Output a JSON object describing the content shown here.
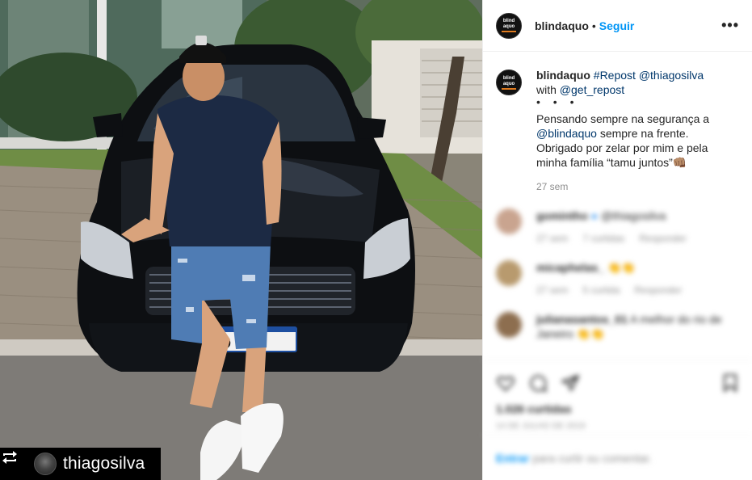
{
  "photo": {
    "repost_user": "thiagosilva",
    "plate_text": "FD  98"
  },
  "post_header": {
    "username": "blindaquo",
    "separator": "•",
    "follow_label": "Seguir",
    "more_label": "•••",
    "logo_text_1": "blind",
    "logo_text_2": "aquo"
  },
  "caption": {
    "username": "blindaquo",
    "hashtag": "#Repost",
    "mention_user": "@thiagosilva",
    "with_word": "with",
    "mention_app": "@get_repost",
    "dots": "• • •",
    "line1": "Pensando sempre na segurança a",
    "mention_brand": "@blindaquo",
    "line2": " sempre na frente.",
    "line3": "Obrigado por zelar por mim e pela",
    "line4": "minha família “tamu juntos”",
    "emoji": "👊🏽",
    "time": "27 sem"
  },
  "comments": [
    {
      "user": "gomintho",
      "text": "@thiagosilva",
      "time": "27 sem",
      "likes": "7 curtidas",
      "reply": "Responder",
      "color": "#c9a48f"
    },
    {
      "user": "micaphelas_",
      "text": "👏👏",
      "time": "27 sem",
      "likes": "5 curtida",
      "reply": "Responder",
      "color": "#b89a6e"
    },
    {
      "user": "julianasantos_01",
      "text": "A melhor do rio de",
      "text2": "Janeiro 👏👏",
      "color": "#8d6e4f"
    }
  ],
  "actions": {
    "likes": "1.026 curtidas",
    "date": "14 DE JULHO DE 2019"
  },
  "login": {
    "enter": "Entrar",
    "rest": "para curtir ou comentar."
  },
  "colors": {
    "accent_blue": "#0095f6",
    "link_blue": "#00376b",
    "muted": "#8e8e8e",
    "logo_orange": "#e07b1f"
  }
}
